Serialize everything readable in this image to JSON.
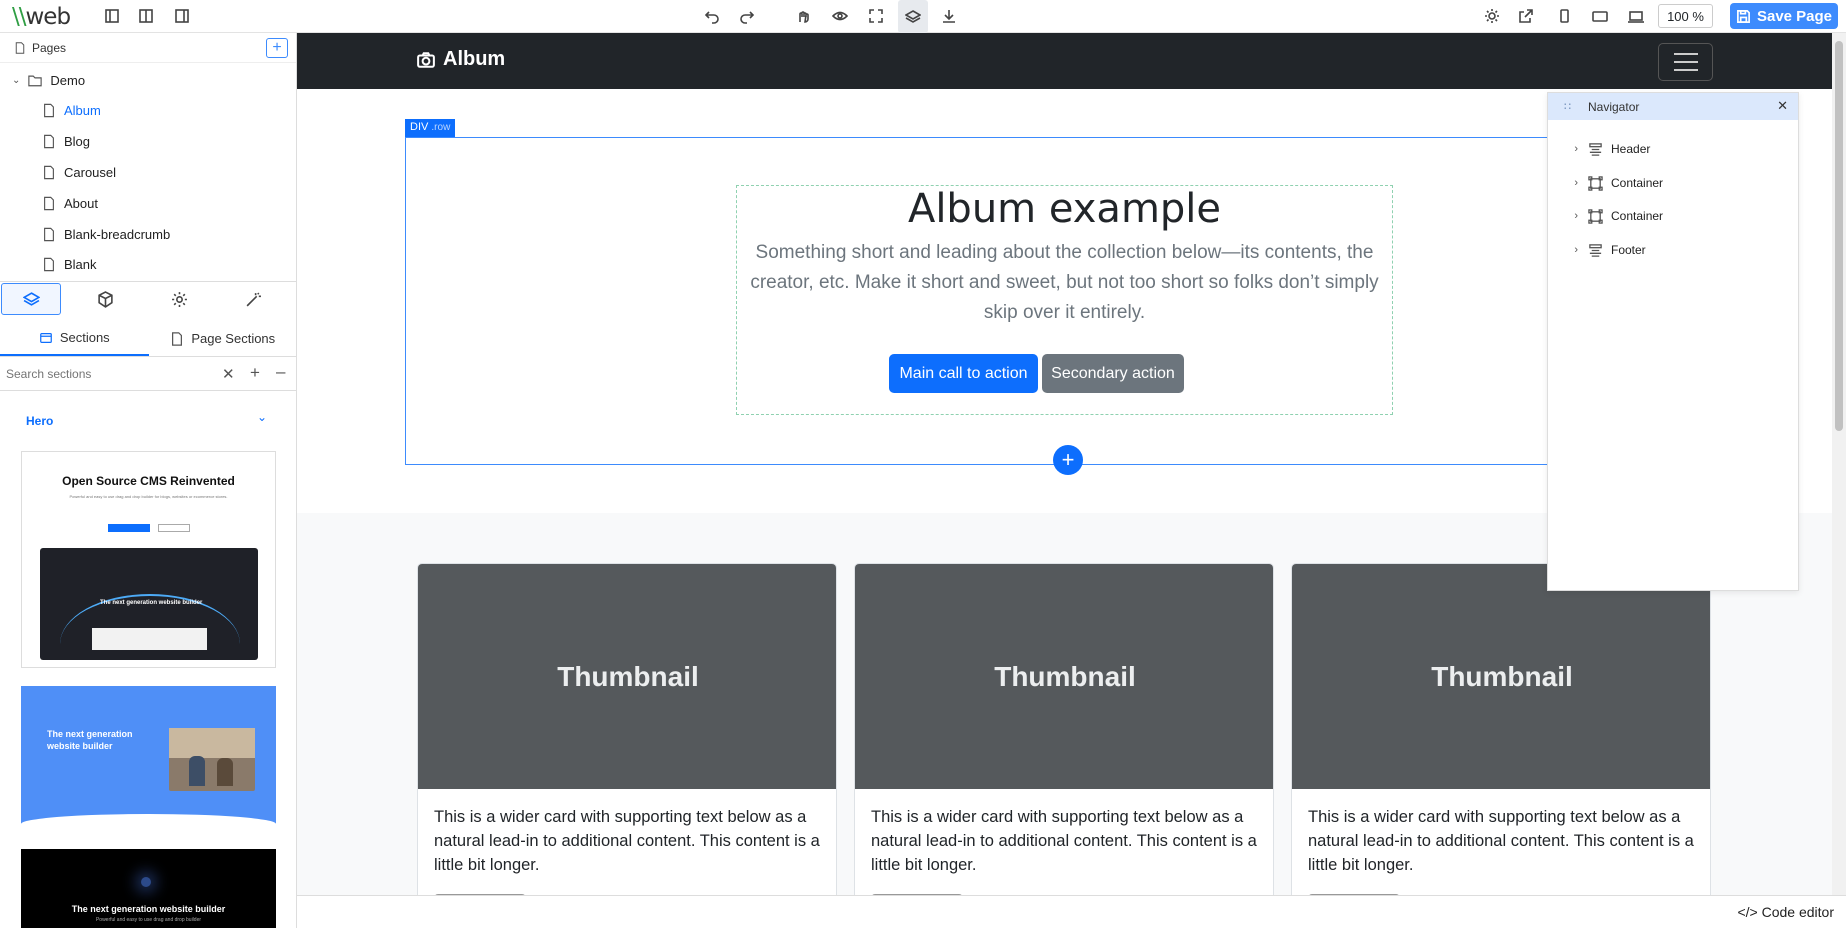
{
  "app": {
    "logo_main": "web",
    "logo_prefix": "\\\\"
  },
  "toolbar": {
    "zoom": "100 %",
    "save_label": "Save Page"
  },
  "pages": {
    "title": "Pages",
    "folder": "Demo",
    "items": [
      "Album",
      "Blog",
      "Carousel",
      "About",
      "Blank-breadcrumb",
      "Blank"
    ],
    "active": "Album"
  },
  "sections_panel": {
    "tab_sections": "Sections",
    "tab_page_sections": "Page Sections",
    "search_placeholder": "Search sections",
    "group": "Hero",
    "thumb1_title": "Open Source CMS Reinvented",
    "thumb1_sub": "Powerful and easy to use drag and drop builder for blogs, websites or ecommerce stores.",
    "thumb1_inner": "The next generation website builder",
    "thumb2_title": "The next generation website builder",
    "thumb3_title": "The next generation website builder",
    "thumb3_sub": "Powerful and easy to use drag and drop builder"
  },
  "canvas": {
    "brand": "Album",
    "selection_tag": "DIV",
    "selection_class": ".row",
    "hero_title": "Album example",
    "hero_text": "Something short and leading about the collection below—its contents, the creator, etc. Make it short and sweet, but not too short so folks don’t simply skip over it entirely.",
    "primary_cta": "Main call to action",
    "secondary_cta": "Secondary action",
    "cards": [
      {
        "thumb": "Thumbnail",
        "text": "This is a wider card with supporting text below as a natural lead-in to additional content. This content is a little bit longer."
      },
      {
        "thumb": "Thumbnail",
        "text": "This is a wider card with supporting text below as a natural lead-in to additional content. This content is a little bit longer."
      },
      {
        "thumb": "Thumbnail",
        "text": "This is a wider card with supporting text below as a natural lead-in to additional content. This content is a little bit longer."
      }
    ]
  },
  "navigator": {
    "title": "Navigator",
    "items": [
      "Header",
      "Container",
      "Container",
      "Footer"
    ]
  },
  "footer": {
    "code_editor": "Code editor"
  },
  "colors": {
    "accent": "#0d6efd",
    "navbar": "#212529",
    "thumbnail_bg": "#55595c",
    "secondary": "#6c757d"
  }
}
